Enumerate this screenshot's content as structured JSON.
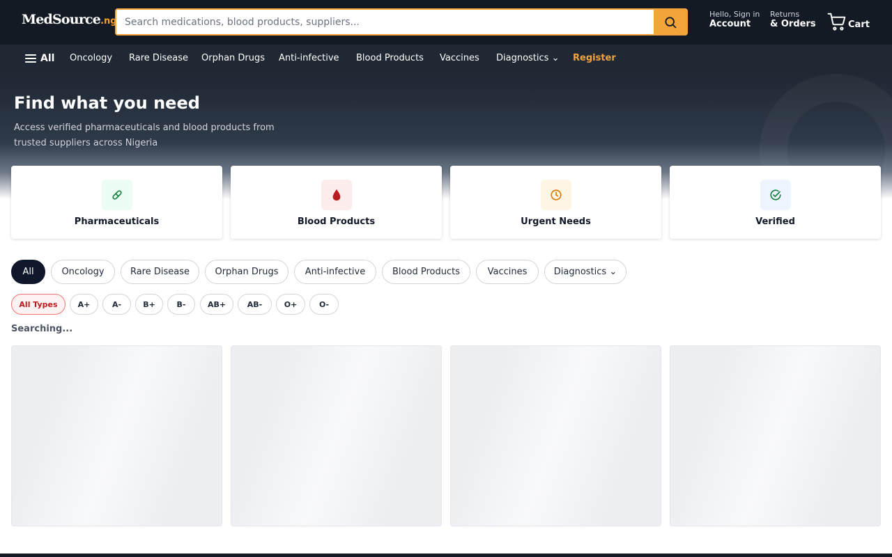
{
  "header": {
    "logo_main": "MedSource",
    "logo_tld": ".ng",
    "search_placeholder": "Search medications, blood products, suppliers...",
    "account_small": "Hello, Sign in",
    "account_big": "Account",
    "orders_small": "Returns",
    "orders_big": "& Orders",
    "cart_label": "Cart"
  },
  "nav": {
    "all_label": "All",
    "items": [
      "Oncology",
      "Rare Disease",
      "Orphan Drugs",
      "Anti-infective",
      "Blood Products",
      "Vaccines",
      "Diagnostics ⌄"
    ],
    "register_label": "Register"
  },
  "hero": {
    "title": "Find what you need",
    "subtitle": "Access verified pharmaceuticals and blood products from trusted suppliers across Nigeria"
  },
  "features": [
    {
      "label": "Pharmaceuticals",
      "icon": "pill-icon",
      "color": "#15803d",
      "bg": "#ecfdf3"
    },
    {
      "label": "Blood Products",
      "icon": "blood-drop-icon",
      "color": "#b91c1c",
      "bg": "#fdecec"
    },
    {
      "label": "Urgent Needs",
      "icon": "clock-icon",
      "color": "#d97706",
      "bg": "#fef6e4"
    },
    {
      "label": "Verified",
      "icon": "check-circle-icon",
      "color": "#15803d",
      "bg": "#eef4fd"
    }
  ],
  "categories": [
    "All",
    "Oncology",
    "Rare Disease",
    "Orphan Drugs",
    "Anti-infective",
    "Blood Products",
    "Vaccines",
    "Diagnostics ⌄"
  ],
  "blood_types": [
    "All Types",
    "A+",
    "A-",
    "B+",
    "B-",
    "AB+",
    "AB-",
    "O+",
    "O-"
  ],
  "status_text": "Searching...",
  "colors": {
    "accent": "#f3a53c",
    "header_bg": "#131a24",
    "nav_bg": "#1f2833"
  }
}
